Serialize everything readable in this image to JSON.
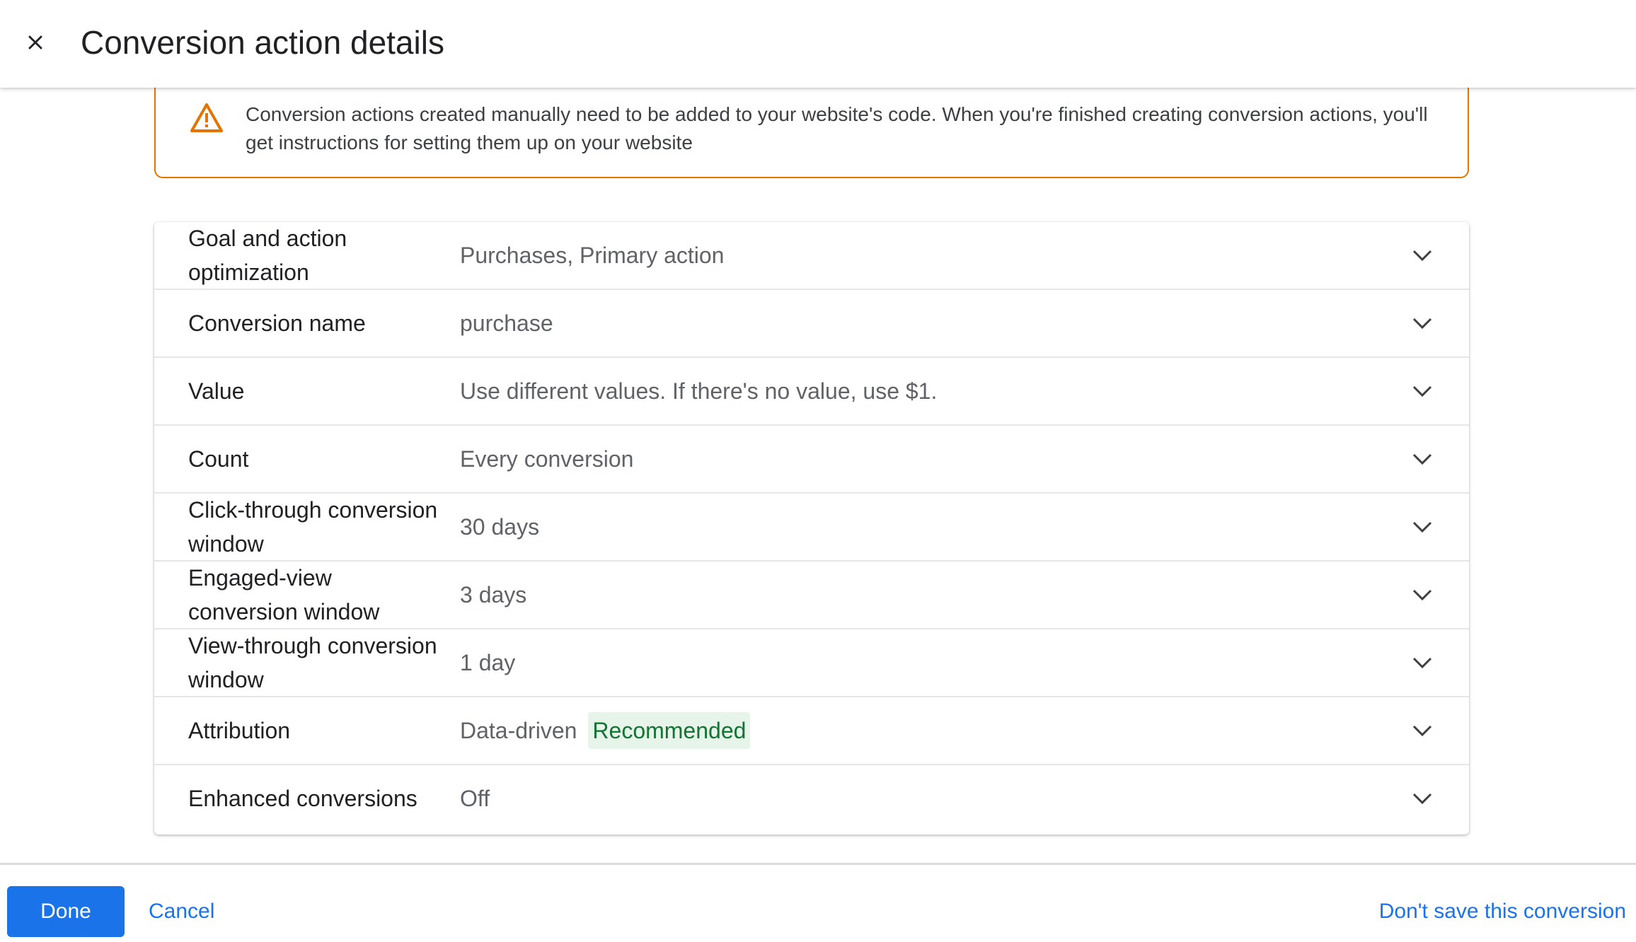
{
  "header": {
    "title": "Conversion action details",
    "close_icon": "close-icon"
  },
  "notice": {
    "icon": "warning-icon",
    "accent_color": "#e37400",
    "text": "Conversion actions created manually need to be added to your website's code. When you're finished creating conversion actions, you'll get instructions for setting them up on your website"
  },
  "settings": {
    "rows": [
      {
        "label": "Goal and action optimization",
        "value": "Purchases, Primary action"
      },
      {
        "label": "Conversion name",
        "value": "purchase"
      },
      {
        "label": "Value",
        "value": "Use different values. If there's no value, use $1."
      },
      {
        "label": "Count",
        "value": "Every conversion"
      },
      {
        "label": "Click-through conversion window",
        "value": "30 days"
      },
      {
        "label": "Engaged-view conversion window",
        "value": "3 days"
      },
      {
        "label": "View-through conversion window",
        "value": "1 day"
      },
      {
        "label": "Attribution",
        "value": "Data-driven",
        "badge": "Recommended"
      },
      {
        "label": "Enhanced conversions",
        "value": "Off"
      }
    ],
    "chevron_icon": "chevron-down-icon"
  },
  "footer": {
    "done_label": "Done",
    "cancel_label": "Cancel",
    "dont_save_label": "Don't save this conversion"
  },
  "colors": {
    "primary": "#1a73e8",
    "warning": "#e37400",
    "badge_bg": "#e6f4ea",
    "badge_text": "#137333"
  }
}
